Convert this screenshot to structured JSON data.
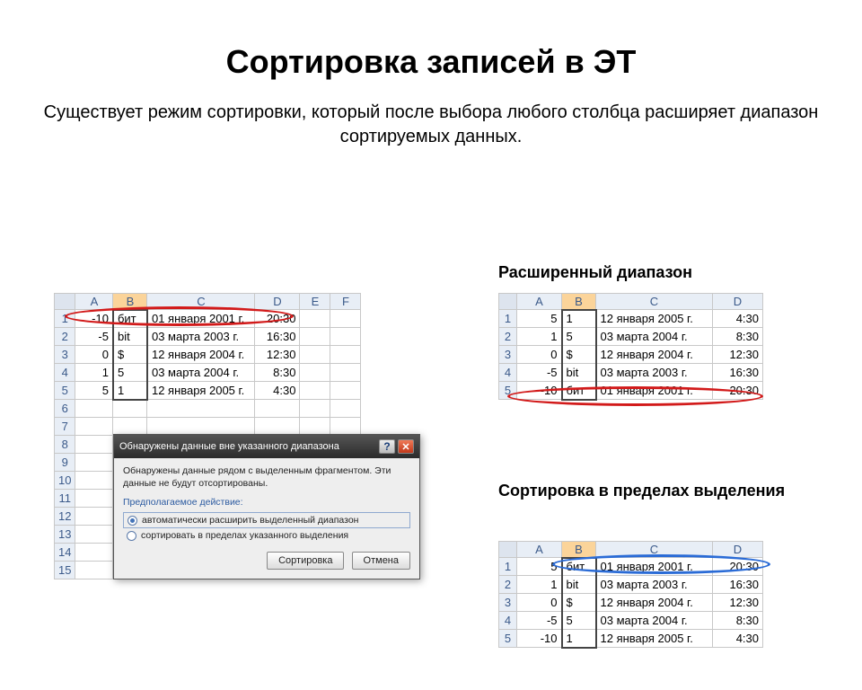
{
  "title": "Сортировка записей в ЭТ",
  "subtitle": "Существует режим сортировки, который после выбора любого столбца расширяет диапазон сортируемых данных.",
  "headings": {
    "expanded": "Расширенный диапазон",
    "within": "Сортировка в пределах выделения"
  },
  "dialog": {
    "title": "Обнаружены данные вне указанного диапазона",
    "message": "Обнаружены данные рядом с выделенным фрагментом. Эти данные не будут отсортированы.",
    "section": "Предполагаемое действие:",
    "opt1": "автоматически расширить выделенный диапазон",
    "opt2": "сортировать в пределах указанного выделения",
    "sort_btn": "Сортировка",
    "cancel_btn": "Отмена"
  },
  "cols": {
    "A": "A",
    "B": "B",
    "C": "C",
    "D": "D",
    "E": "E",
    "F": "F"
  },
  "left_rows": [
    {
      "n": "1",
      "a": "-10",
      "b": "бит",
      "c": "01 января 2001 г.",
      "d": "20:30"
    },
    {
      "n": "2",
      "a": "-5",
      "b": "bit",
      "c": "03 марта 2003 г.",
      "d": "16:30"
    },
    {
      "n": "3",
      "a": "0",
      "b": "$",
      "c": "12 января 2004 г.",
      "d": "12:30"
    },
    {
      "n": "4",
      "a": "1",
      "b": "5",
      "c": "03 марта 2004 г.",
      "d": "8:30"
    },
    {
      "n": "5",
      "a": "5",
      "b": "1",
      "c": "12 января 2005 г.",
      "d": "4:30"
    },
    {
      "n": "6"
    },
    {
      "n": "7"
    },
    {
      "n": "8"
    },
    {
      "n": "9"
    },
    {
      "n": "10"
    },
    {
      "n": "11"
    },
    {
      "n": "12"
    },
    {
      "n": "13"
    },
    {
      "n": "14"
    },
    {
      "n": "15"
    }
  ],
  "expanded_rows": [
    {
      "n": "1",
      "a": "5",
      "b": "1",
      "c": "12 января 2005 г.",
      "d": "4:30"
    },
    {
      "n": "2",
      "a": "1",
      "b": "5",
      "c": "03 марта 2004 г.",
      "d": "8:30"
    },
    {
      "n": "3",
      "a": "0",
      "b": "$",
      "c": "12 января 2004 г.",
      "d": "12:30"
    },
    {
      "n": "4",
      "a": "-5",
      "b": "bit",
      "c": "03 марта 2003 г.",
      "d": "16:30"
    },
    {
      "n": "5",
      "a": "-10",
      "b": "бит",
      "c": "01 января 2001 г.",
      "d": "20:30"
    }
  ],
  "within_rows": [
    {
      "n": "1",
      "a": "5",
      "b": "бит",
      "c": "01 января 2001 г.",
      "d": "20:30"
    },
    {
      "n": "2",
      "a": "1",
      "b": "bit",
      "c": "03 марта 2003 г.",
      "d": "16:30"
    },
    {
      "n": "3",
      "a": "0",
      "b": "$",
      "c": "12 января 2004 г.",
      "d": "12:30"
    },
    {
      "n": "4",
      "a": "-5",
      "b": "5",
      "c": "03 марта 2004 г.",
      "d": "8:30"
    },
    {
      "n": "5",
      "a": "-10",
      "b": "1",
      "c": "12 января 2005 г.",
      "d": "4:30"
    }
  ]
}
